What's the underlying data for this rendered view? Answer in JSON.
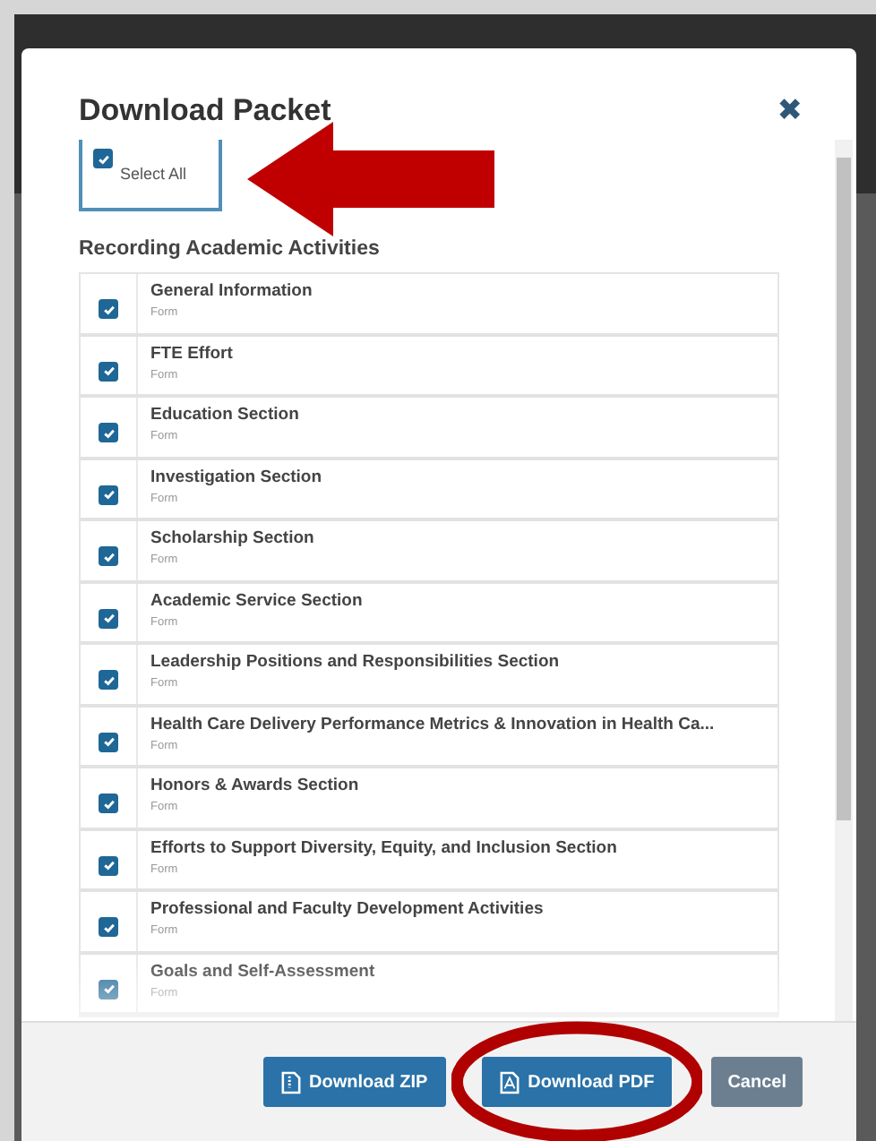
{
  "dialog": {
    "title": "Download Packet",
    "close_icon": "✖"
  },
  "select_all": {
    "label": "Select All",
    "checked": true
  },
  "section": {
    "heading": "Recording Academic Activities"
  },
  "items": [
    {
      "title": "General Information",
      "type": "Form",
      "checked": true
    },
    {
      "title": "FTE Effort",
      "type": "Form",
      "checked": true
    },
    {
      "title": "Education Section",
      "type": "Form",
      "checked": true
    },
    {
      "title": "Investigation Section",
      "type": "Form",
      "checked": true
    },
    {
      "title": "Scholarship Section",
      "type": "Form",
      "checked": true
    },
    {
      "title": "Academic Service Section",
      "type": "Form",
      "checked": true
    },
    {
      "title": "Leadership Positions and Responsibilities Section",
      "type": "Form",
      "checked": true
    },
    {
      "title": "Health Care Delivery Performance Metrics & Innovation in Health Ca...",
      "type": "Form",
      "checked": true
    },
    {
      "title": "Honors & Awards Section",
      "type": "Form",
      "checked": true
    },
    {
      "title": "Efforts to Support Diversity, Equity, and Inclusion Section",
      "type": "Form",
      "checked": true
    },
    {
      "title": "Professional and Faculty Development Activities",
      "type": "Form",
      "checked": true
    },
    {
      "title": "Goals and Self-Assessment",
      "type": "Form",
      "checked": true
    }
  ],
  "buttons": [
    {
      "label": "Download ZIP",
      "kind": "zip"
    },
    {
      "label": "Download PDF",
      "kind": "pdf"
    },
    {
      "label": "Cancel",
      "kind": "cancel"
    }
  ]
}
